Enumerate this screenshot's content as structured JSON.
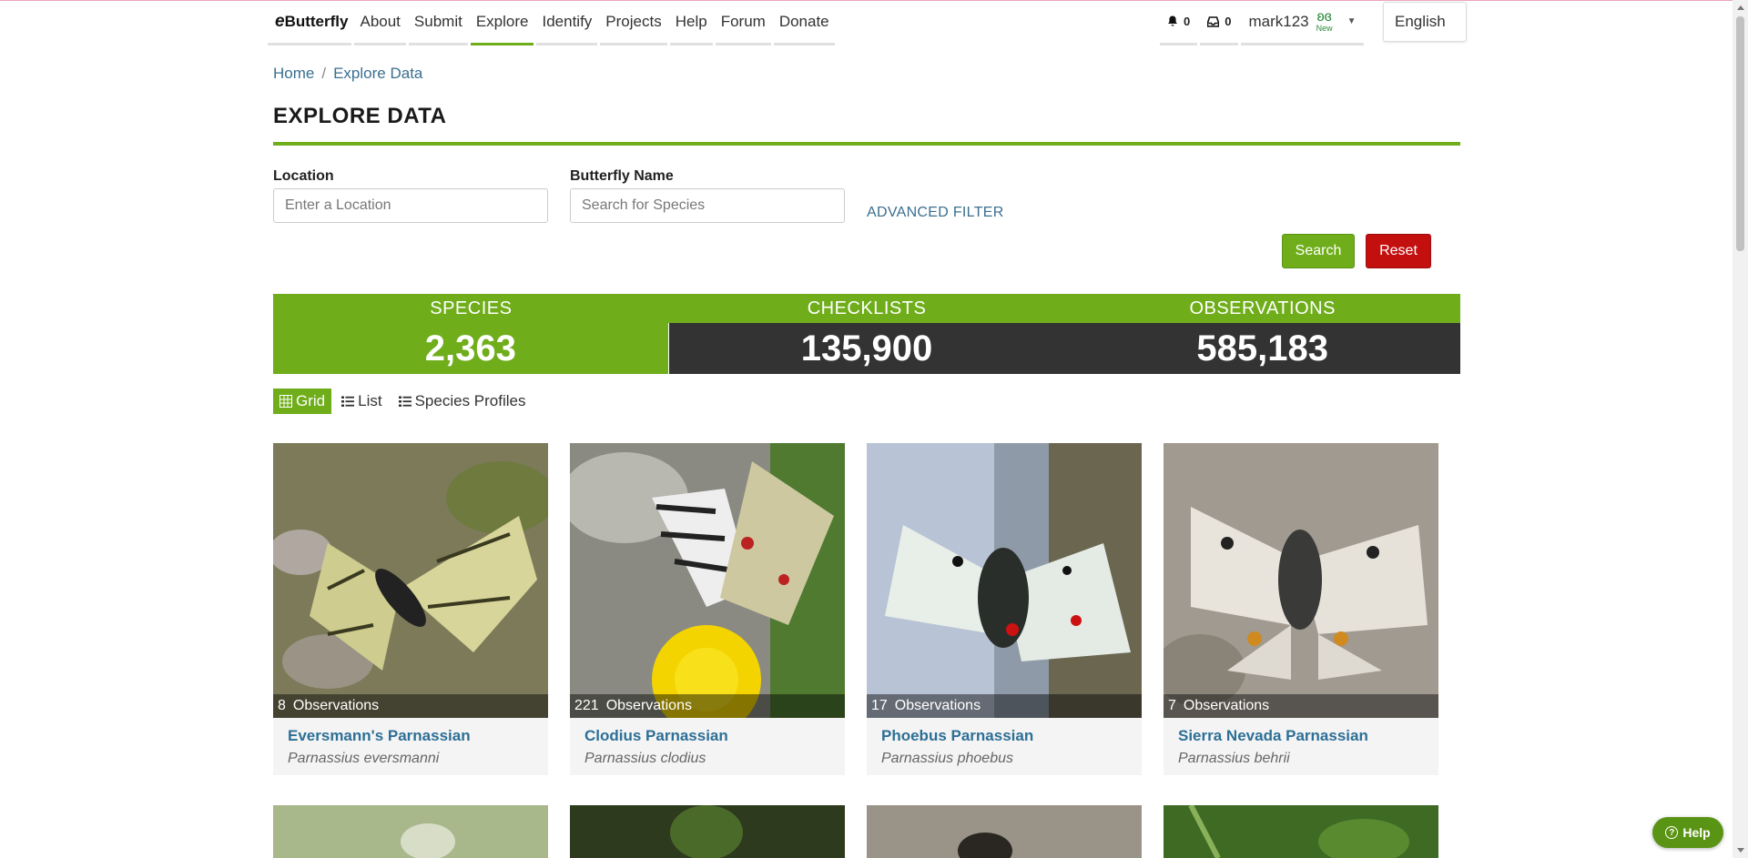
{
  "nav": {
    "logo": {
      "prefix": "e",
      "rest": "Butterfly"
    },
    "items": [
      "About",
      "Submit",
      "Explore",
      "Identify",
      "Projects",
      "Help",
      "Forum",
      "Donate"
    ],
    "active": "Explore",
    "notifications": "0",
    "messages": "0",
    "username": "mark123",
    "new_badge": "New",
    "language": "English"
  },
  "breadcrumb": {
    "home": "Home",
    "current": "Explore Data"
  },
  "page_title": "EXPLORE DATA",
  "filters": {
    "location_label": "Location",
    "location_placeholder": "Enter a Location",
    "name_label": "Butterfly Name",
    "name_placeholder": "Search for Species",
    "advanced": "ADVANCED FILTER",
    "search_btn": "Search",
    "reset_btn": "Reset"
  },
  "stats": {
    "species_label": "SPECIES",
    "species_value": "2,363",
    "checklists_label": "CHECKLISTS",
    "checklists_value": "135,900",
    "observations_label": "OBSERVATIONS",
    "observations_value": "585,183"
  },
  "views": {
    "grid": "Grid",
    "list": "List",
    "profiles": "Species Profiles"
  },
  "obs_word": "Observations",
  "cards": [
    {
      "count": "8",
      "name": "Eversmann's Parnassian",
      "sci": "Parnassius eversmanni"
    },
    {
      "count": "221",
      "name": "Clodius Parnassian",
      "sci": "Parnassius clodius"
    },
    {
      "count": "17",
      "name": "Phoebus Parnassian",
      "sci": "Parnassius phoebus"
    },
    {
      "count": "7",
      "name": "Sierra Nevada Parnassian",
      "sci": "Parnassius behrii"
    }
  ],
  "help": "Help",
  "colors": {
    "brand_green": "#6fae1a",
    "link_blue": "#2d6f96",
    "reset_red": "#c40f0f",
    "dark": "#333333"
  }
}
